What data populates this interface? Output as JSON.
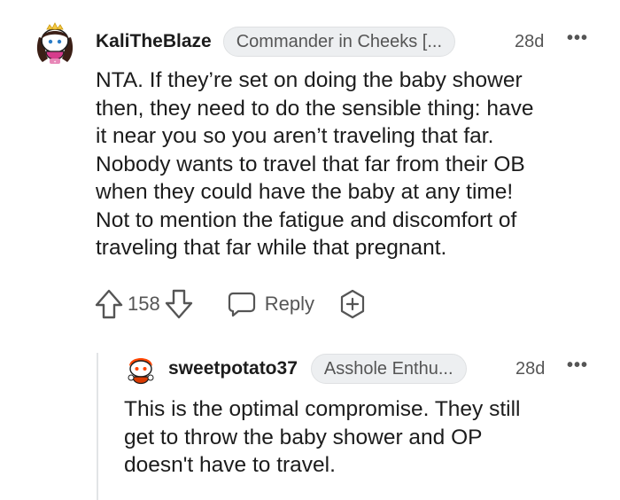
{
  "comment": {
    "username": "KaliTheBlaze",
    "flair": "Commander in Cheeks [...",
    "time": "28d",
    "more": "•••",
    "body": "NTA. If they’re set on doing the baby shower\nthen, they need to do the sensible thing: have\nit near you so you aren’t traveling that far.\nNobody wants to travel that far from their OB\nwhen they could have the baby at any time!\nNot to mention the fatigue and discomfort of\ntraveling that far while that pregnant.",
    "votes": "158",
    "reply_label": "Reply",
    "icons": {
      "avatar": "snoo-avatar-icon",
      "upvote": "upvote-arrow-icon",
      "downvote": "downvote-arrow-icon",
      "reply": "speech-bubble-icon",
      "award": "award-plus-icon"
    }
  },
  "reply": {
    "username": "sweetpotato37",
    "flair": "Asshole Enthu...",
    "time": "28d",
    "more": "•••",
    "body": "This is the optimal compromise. They still\nget to throw the baby shower and OP\ndoesn't have to travel.",
    "icons": {
      "avatar": "snoo-avatar-icon"
    }
  },
  "colors": {
    "text": "#1c1c1c",
    "meta": "#555555",
    "flair_bg": "#edeff1",
    "thread_line": "#e2e4e6",
    "reply_avatar_accent": "#ff4500"
  }
}
